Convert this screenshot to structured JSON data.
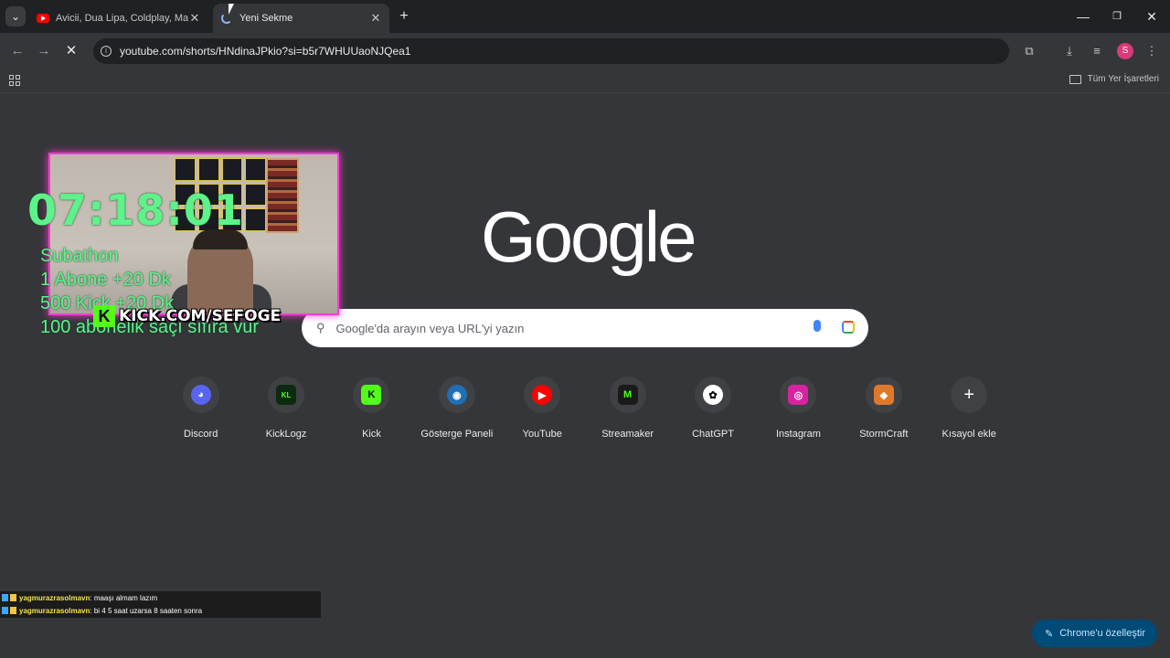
{
  "browser": {
    "tabs": [
      {
        "title": "Avicii, Dua Lipa, Coldplay, Martin",
        "favicon": "youtube-icon",
        "active": false
      },
      {
        "title": "Yeni Sekme",
        "favicon": "loading-spinner-icon",
        "active": true
      }
    ],
    "address": "youtube.com/shorts/HNdinaJPkio?si=b5r7WHUUaoNJQea1",
    "profile_initial": "S",
    "all_bookmarks_label": "Tüm Yer İşaretleri"
  },
  "newtab": {
    "logo": "Google",
    "search_placeholder": "Google'da arayın veya URL'yi yazın",
    "shortcuts": [
      {
        "label": "Discord",
        "icon": "discord-icon",
        "color": "#5865f2",
        "glyph": "◕"
      },
      {
        "label": "KickLogz",
        "icon": "kicklogz-icon",
        "color": "#0c2a10",
        "glyph": "KL"
      },
      {
        "label": "Kick",
        "icon": "kick-icon",
        "color": "#53fc18",
        "glyph": "K"
      },
      {
        "label": "Gösterge Paneli",
        "icon": "dashboard-globe-icon",
        "color": "#1e6fb4",
        "glyph": "◉"
      },
      {
        "label": "YouTube",
        "icon": "youtube-icon",
        "color": "#ff0000",
        "glyph": "▶"
      },
      {
        "label": "Streamaker",
        "icon": "streamaker-icon",
        "color": "#1a1a1a",
        "glyph": "M"
      },
      {
        "label": "ChatGPT",
        "icon": "chatgpt-icon",
        "color": "#ffffff",
        "glyph": "✿"
      },
      {
        "label": "Instagram",
        "icon": "instagram-icon",
        "color": "#d6249f",
        "glyph": "◎"
      },
      {
        "label": "StormCraft",
        "icon": "stormcraft-icon",
        "color": "#e0782b",
        "glyph": "◆"
      },
      {
        "label": "Kısayol ekle",
        "icon": "plus-icon",
        "color": "#404144",
        "glyph": "+"
      }
    ],
    "customize_label": "Chrome'u özelleştir"
  },
  "stream_overlay": {
    "timer": "07:18:01",
    "lines": [
      "Subathon",
      "1 Abone +20 Dk",
      "500 Kick +20 Dk",
      "100 abonelik saçı sıfıra vur"
    ],
    "kick_handle": "KICK.COM/SEFOGE",
    "chat": [
      {
        "user": "yagmurazrasolmavn",
        "message": ": maaşı almam lazım"
      },
      {
        "user": "yagmurazrasolmavn",
        "message": ": bi 4 5 saat uzarsa 8 saaten sonra"
      }
    ]
  }
}
